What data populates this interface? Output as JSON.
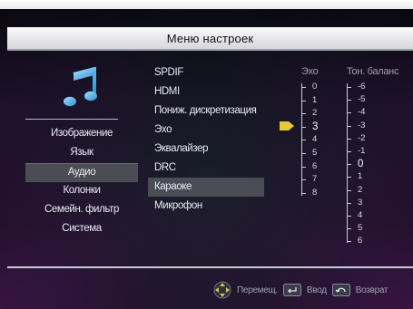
{
  "header": {
    "title": "Меню настроек"
  },
  "categories": [
    {
      "label": "Изображение",
      "selected": false
    },
    {
      "label": "Язык",
      "selected": false
    },
    {
      "label": "Аудио",
      "selected": true
    },
    {
      "label": "Колонки",
      "selected": false
    },
    {
      "label": "Семейн. фильтр",
      "selected": false
    },
    {
      "label": "Система",
      "selected": false
    }
  ],
  "audio_items": [
    {
      "label": "SPDIF",
      "highlighted": false
    },
    {
      "label": "HDMI",
      "highlighted": false
    },
    {
      "label": "Пониж. дискретизация",
      "highlighted": false
    },
    {
      "label": "Эхо",
      "highlighted": false
    },
    {
      "label": "Эквалайзер",
      "highlighted": false
    },
    {
      "label": "DRC",
      "highlighted": false
    },
    {
      "label": "Караоке",
      "highlighted": true
    },
    {
      "label": "Микрофон",
      "highlighted": false
    }
  ],
  "echo": {
    "label": "Эхо",
    "scale": [
      "0",
      "1",
      "2",
      "3",
      "4",
      "5",
      "6",
      "7",
      "8"
    ],
    "current": "3"
  },
  "tone_balance": {
    "label": "Тон. баланс",
    "scale": [
      "-6",
      "-5",
      "-4",
      "-3",
      "-2",
      "-1",
      "0",
      "1",
      "2",
      "3",
      "4",
      "5",
      "6"
    ],
    "current": "0"
  },
  "footer": {
    "move": "Перемещ.",
    "enter": "Ввод",
    "back": "Возврат"
  },
  "colors": {
    "accent_pointer": "#e7c83a",
    "icon_blue": "#5fb7ef"
  }
}
